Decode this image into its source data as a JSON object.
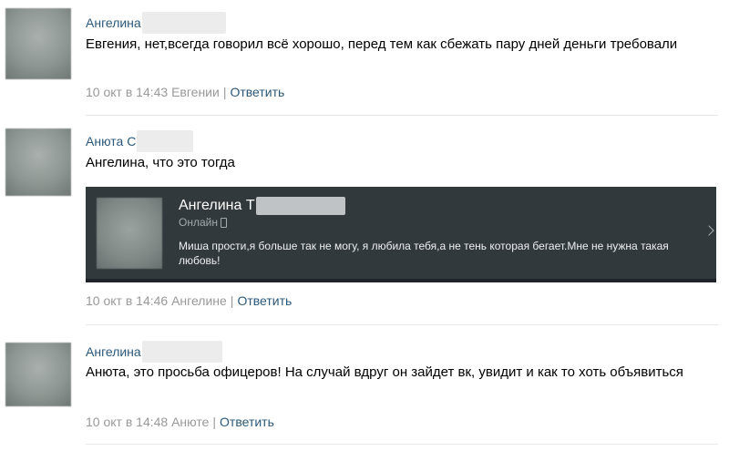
{
  "comments": [
    {
      "author": "Ангелина",
      "text": "Евгения, нет,всегда говорил всё хорошо, перед тем как сбежать пару дней деньги требовали",
      "time": "10 окт в 14:43",
      "reply_to": "Евгении",
      "reply_label": "Ответить"
    },
    {
      "author": "Анюта С",
      "text": "Ангелина, что это тогда",
      "time": "10 окт в 14:46",
      "reply_to": "Ангелине",
      "reply_label": "Ответить",
      "attachment": {
        "name": "Ангелина Т",
        "status": "Онлайн",
        "message": "Миша прости,я больше так не могу, я любила тебя,а не тень которая бегает.Мне не нужна такая любовь!"
      }
    },
    {
      "author": "Ангелина",
      "text": "Анюта, это просьба офицеров! На случай вдруг он зайдет вк, увидит и как то хоть объявиться",
      "time": "10 окт в 14:48",
      "reply_to": "Анюте",
      "reply_label": "Ответить"
    }
  ],
  "colors": {
    "link": "#2b587a",
    "meta": "#999999",
    "divider": "#e7e8ec",
    "attachment_bg": "#32393d"
  },
  "icons": {
    "attachment_status": "phone-icon",
    "attachment_expand": "chevron-right-icon"
  }
}
